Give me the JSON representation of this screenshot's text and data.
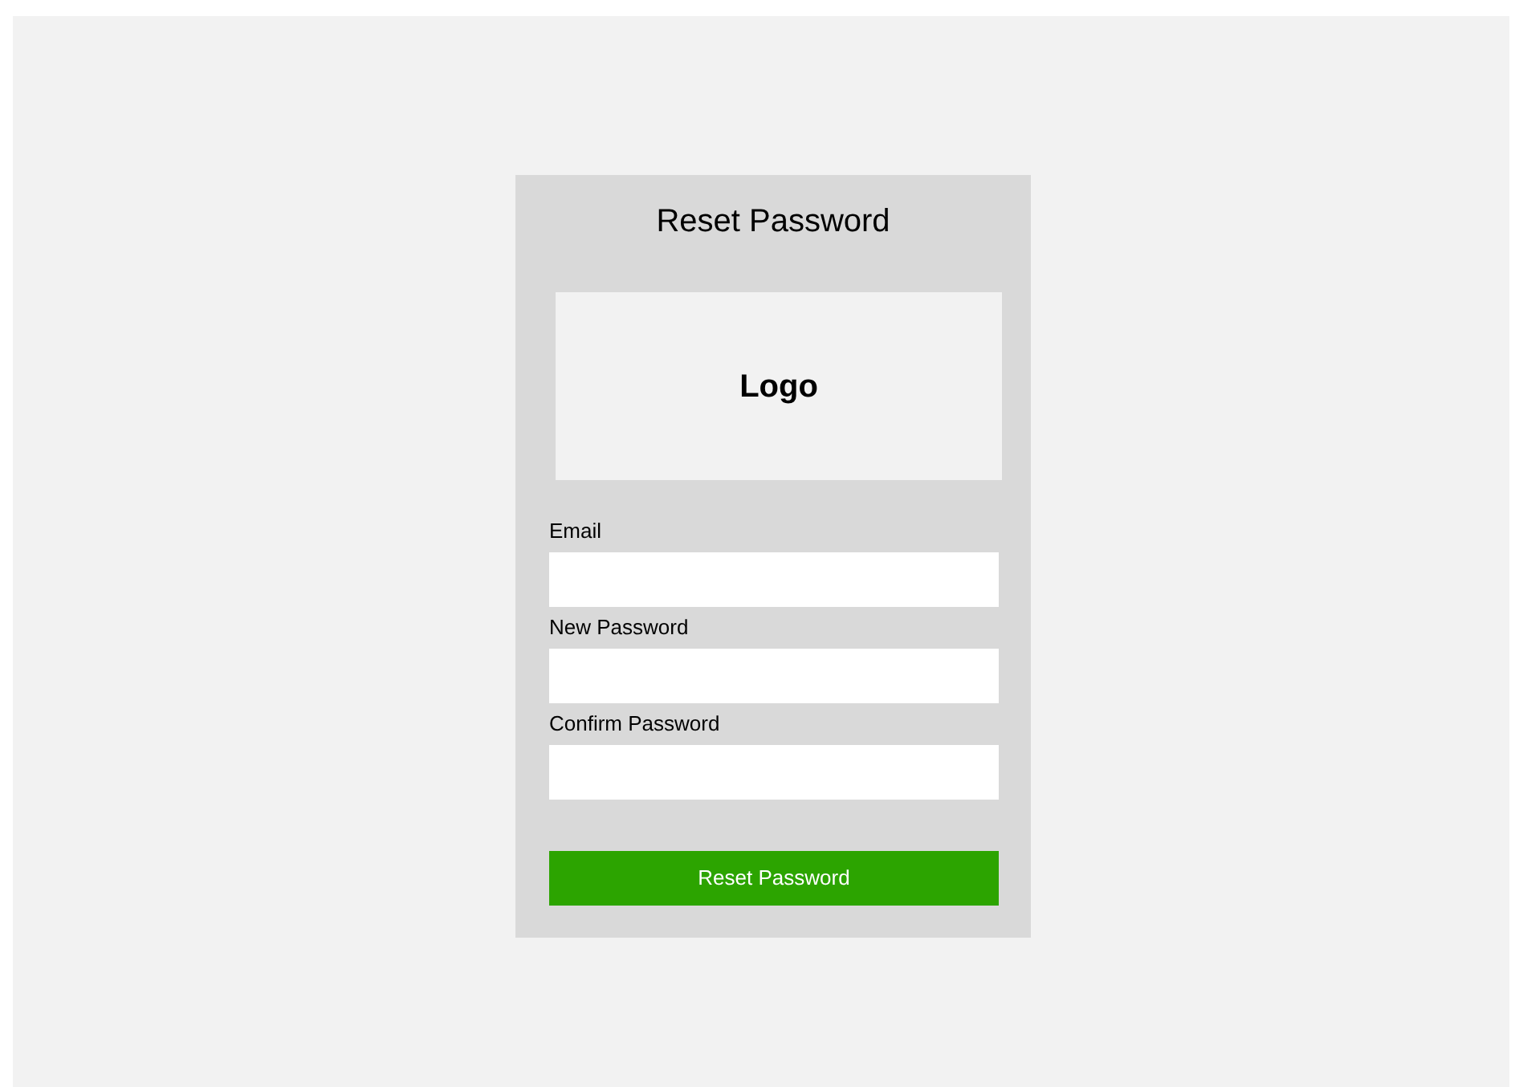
{
  "card": {
    "title": "Reset Password",
    "logo": {
      "text": "Logo"
    },
    "fields": [
      {
        "label": "Email"
      },
      {
        "label": "New Password"
      },
      {
        "label": "Confirm Password"
      }
    ],
    "submit_button": "Reset Password"
  }
}
